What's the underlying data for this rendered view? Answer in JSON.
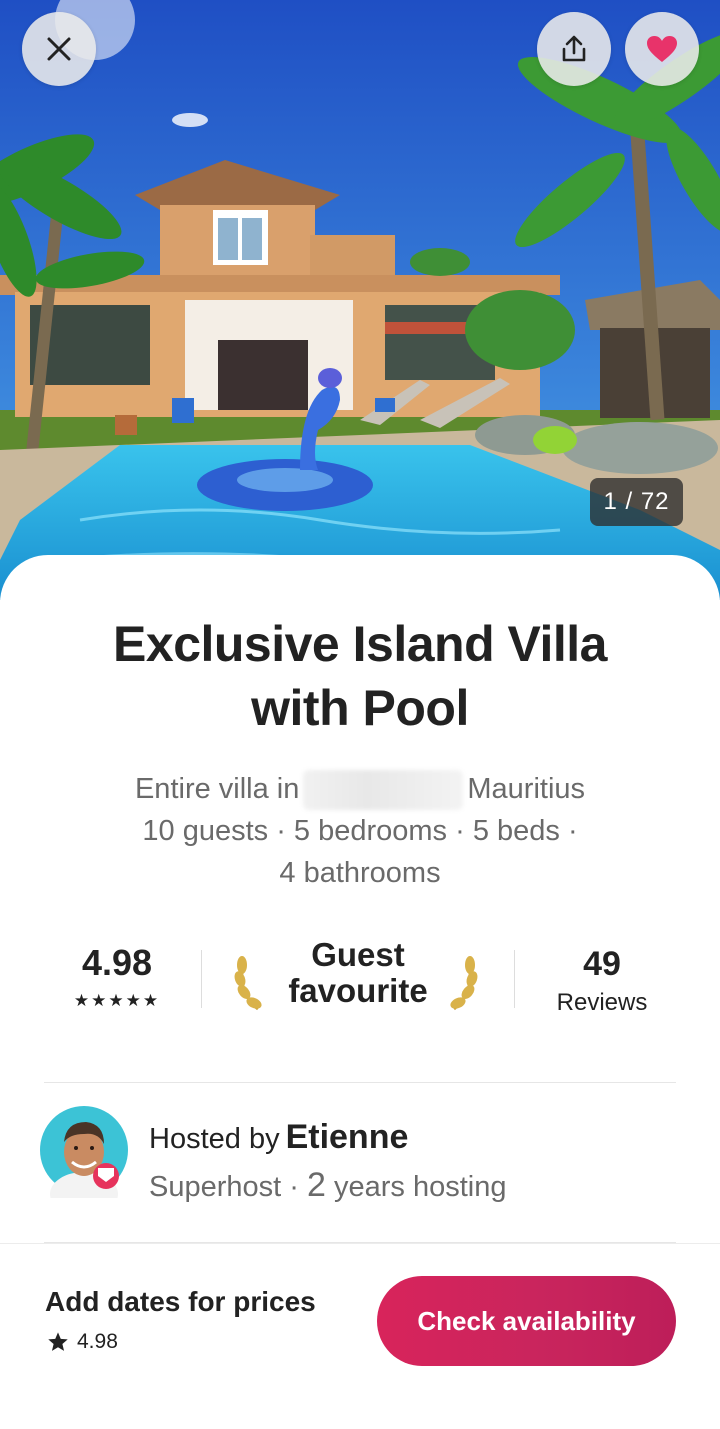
{
  "gallery": {
    "counter": "1 / 72"
  },
  "listing": {
    "title": "Exclusive Island Villa with Pool",
    "type_prefix": "Entire villa in",
    "country": "Mauritius",
    "details_line1": "10 guests · 5 bedrooms · 5 beds ·",
    "details_line2": "4 bathrooms"
  },
  "stats": {
    "rating": "4.98",
    "stars": "★★★★★",
    "badge": "Guest favourite",
    "reviews_count": "49",
    "reviews_label": "Reviews"
  },
  "host": {
    "hosted_by": "Hosted by",
    "name": "Etienne",
    "status": "Superhost ·",
    "years_num": "2",
    "years_text": "years hosting"
  },
  "footer": {
    "price_prompt": "Add dates for prices",
    "rating": "4.98",
    "cta_label": "Check availability"
  },
  "icons": {
    "close": "close-icon",
    "share": "share-icon",
    "favorite": "heart-icon",
    "laurel": "laurel-icon",
    "star": "star-icon"
  },
  "colors": {
    "accent": "#d8245b",
    "heart": "#e8336a",
    "laurel": "#c9a13a"
  }
}
